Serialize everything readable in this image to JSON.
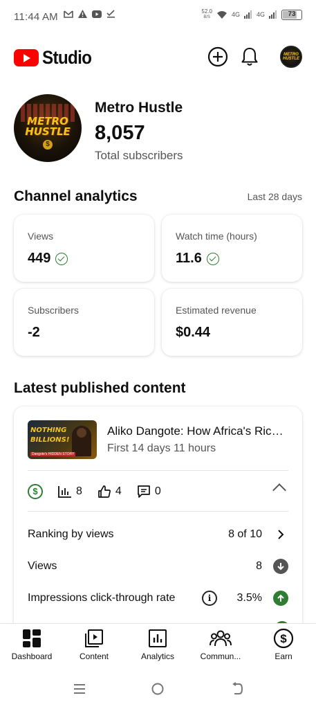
{
  "status_bar": {
    "time": "11:44 AM",
    "notification_icons": [
      "gmail-icon",
      "alert-icon",
      "youtube-icon",
      "check-download-icon"
    ],
    "net_speed_value": "52.0",
    "net_speed_unit": "B/S",
    "network_1": "4G",
    "network_2": "4G",
    "battery": "73"
  },
  "header": {
    "app_name": "Studio",
    "brand_color": "#ff0000",
    "create_icon": "add-circle-icon",
    "notifications_icon": "bell-icon",
    "avatar_text": "METRO HUSTLE"
  },
  "channel": {
    "avatar_line1": "METRO",
    "avatar_line2": "HUSTLE",
    "avatar_coin": "$",
    "name": "Metro Hustle",
    "subscribers": "8,057",
    "subscribers_label": "Total subscribers"
  },
  "analytics": {
    "title": "Channel analytics",
    "period": "Last 28 days",
    "cards": [
      {
        "label": "Views",
        "value": "449",
        "verified": true
      },
      {
        "label": "Watch time (hours)",
        "value": "11.6",
        "verified": true
      },
      {
        "label": "Subscribers",
        "value": "-2",
        "verified": false
      },
      {
        "label": "Estimated revenue",
        "value": "$0.44",
        "verified": false
      }
    ]
  },
  "latest": {
    "title": "Latest published content",
    "video": {
      "thumb_line1": "NOTHING",
      "thumb_line2": "BILLIONS!",
      "thumb_tag": "Dangote's HIDDEN STORY",
      "title": "Aliko Dangote: How Africa's Richest Man Built His Empire",
      "subtitle": "First 14 days 11 hours",
      "views_stat": "8",
      "likes_stat": "4",
      "comments_stat": "0"
    },
    "metrics": [
      {
        "label": "Ranking by views",
        "value": "8 of 10"
      },
      {
        "label": "Views",
        "value": "8"
      },
      {
        "label": "Impressions click-through rate",
        "value": "3.5%"
      }
    ]
  },
  "bottom_nav": [
    {
      "label": "Dashboard",
      "icon": "dashboard-icon"
    },
    {
      "label": "Content",
      "icon": "content-icon"
    },
    {
      "label": "Analytics",
      "icon": "analytics-icon"
    },
    {
      "label": "Commun...",
      "icon": "community-icon"
    },
    {
      "label": "Earn",
      "icon": "earn-icon"
    }
  ],
  "colors": {
    "green": "#2e7d32",
    "dark_gray_badge": "#555555",
    "text_secondary": "#555555"
  }
}
